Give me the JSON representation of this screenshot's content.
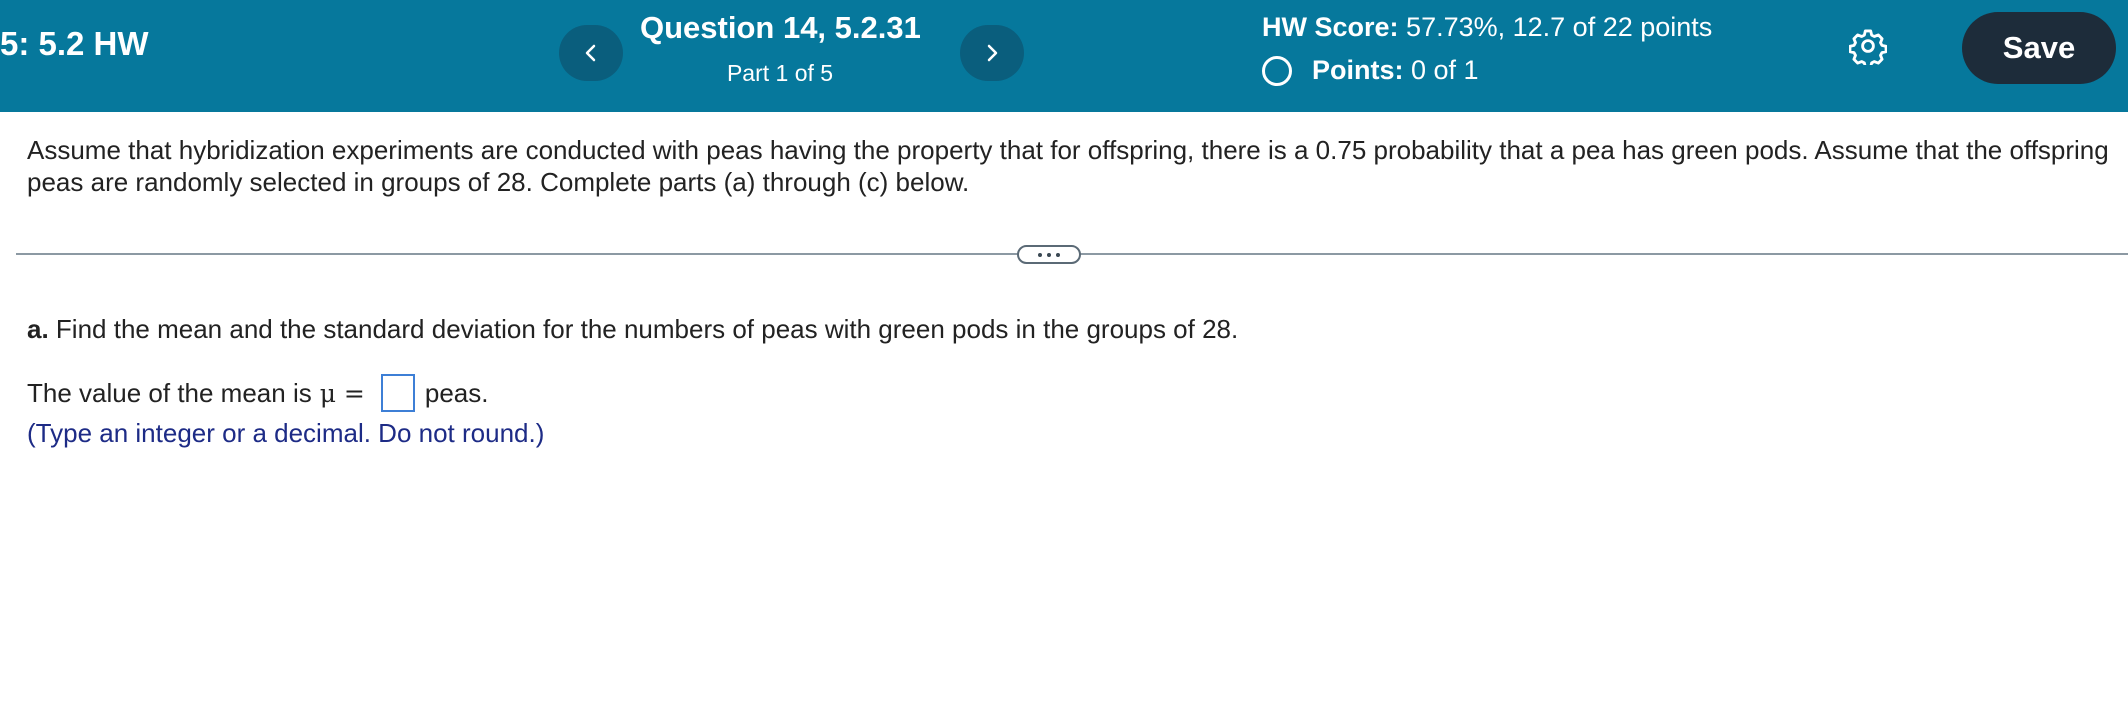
{
  "header": {
    "assignment_title": "5: 5.2 HW",
    "question_title": "Question 14, 5.2.31",
    "question_part": "Part 1 of 5",
    "hw_score_label": "HW Score:",
    "hw_score_value": "57.73%, 12.7 of 22 points",
    "points_label": "Points:",
    "points_value": "0 of 1",
    "save_label": "Save",
    "prev_icon": "chevron-left-icon",
    "next_icon": "chevron-right-icon",
    "settings_icon": "gear-icon",
    "colors": {
      "header_bg": "#06789c",
      "save_bg": "#1d2c3a",
      "nav_bg": "#0a5e7d"
    }
  },
  "problem": {
    "statement": "Assume that hybridization experiments are conducted with peas having the property that for offspring, there is a 0.75 probability that a pea has green pods. Assume that the offspring peas are randomly selected in groups of 28. Complete parts (a) through (c) below."
  },
  "part_a": {
    "label": "a.",
    "question": "Find the mean and the standard deviation for the numbers of peas with green pods in the groups of 28.",
    "answer_prefix": "The value of the mean is",
    "mu_symbol": "μ =",
    "answer_value": "",
    "answer_suffix": "peas.",
    "hint": "(Type an integer or a decimal. Do not round.)",
    "hint_color": "#1d2b86"
  }
}
